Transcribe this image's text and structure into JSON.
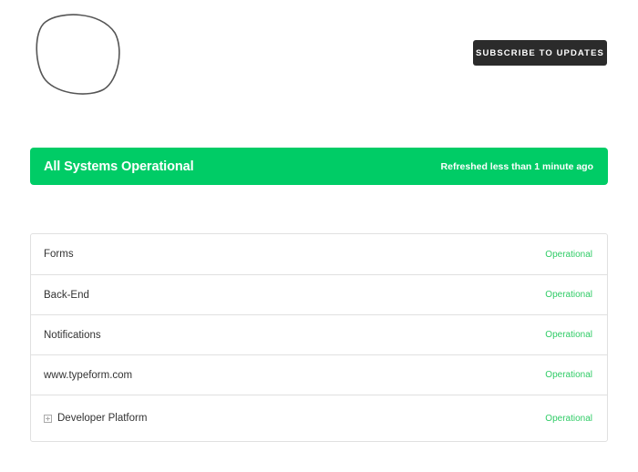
{
  "header": {
    "subscribe_label": "Subscribe to Updates"
  },
  "status_banner": {
    "title": "All Systems Operational",
    "refreshed": "Refreshed less than 1 minute ago",
    "color": "#00cc66"
  },
  "colors": {
    "operational": "#2fcc66",
    "button_bg": "#2b2b2b"
  },
  "components": [
    {
      "name": "Forms",
      "status": "Operational"
    },
    {
      "name": "Back-End",
      "status": "Operational"
    },
    {
      "name": "Notifications",
      "status": "Operational"
    },
    {
      "name": "www.typeform.com",
      "status": "Operational"
    },
    {
      "name": "Developer Platform",
      "status": "Operational",
      "expandable": true,
      "icon": "plus-square-icon"
    }
  ]
}
